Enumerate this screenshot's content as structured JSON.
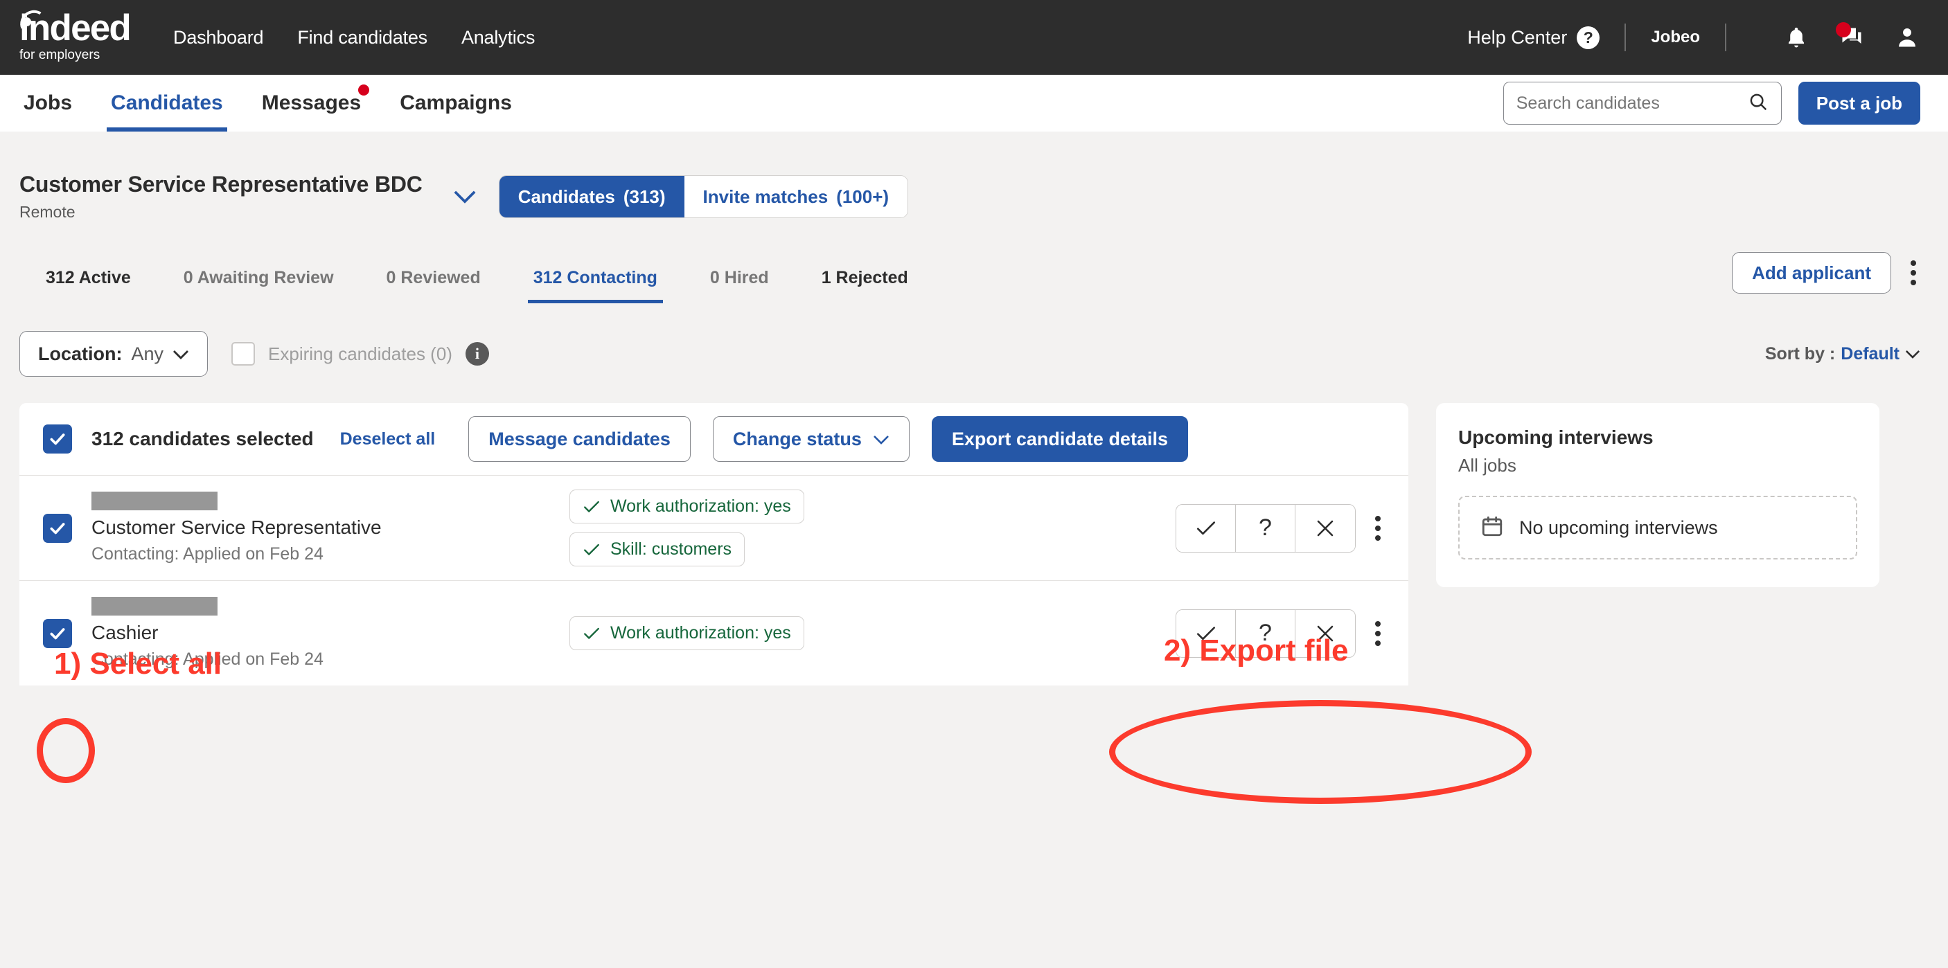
{
  "topbar": {
    "logo_word": "indeed",
    "logo_sub": "for employers",
    "nav": [
      {
        "label": "Dashboard"
      },
      {
        "label": "Find candidates"
      },
      {
        "label": "Analytics"
      }
    ],
    "help_label": "Help Center",
    "help_badge": "?",
    "account": "Jobeo",
    "icons": [
      "bell-icon",
      "messages-icon",
      "profile-icon"
    ]
  },
  "subnav": {
    "items": [
      {
        "label": "Jobs",
        "active": false,
        "dot": false
      },
      {
        "label": "Candidates",
        "active": true,
        "dot": false
      },
      {
        "label": "Messages",
        "active": false,
        "dot": true
      },
      {
        "label": "Campaigns",
        "active": false,
        "dot": false
      }
    ],
    "search_placeholder": "Search candidates",
    "search_value": "",
    "post_job_label": "Post a job"
  },
  "job": {
    "title": "Customer Service Representative BDC",
    "location": "Remote",
    "toggle": [
      {
        "label": "Candidates",
        "count": "(313)",
        "active": true
      },
      {
        "label": "Invite matches",
        "count": "(100+)",
        "active": false
      }
    ]
  },
  "tabs": [
    {
      "label": "312 Active",
      "state": "dark"
    },
    {
      "label": "0 Awaiting Review",
      "state": "muted"
    },
    {
      "label": "0 Reviewed",
      "state": "muted"
    },
    {
      "label": "312 Contacting",
      "state": "active"
    },
    {
      "label": "0 Hired",
      "state": "muted"
    },
    {
      "label": "1 Rejected",
      "state": "dark"
    }
  ],
  "tabs_right": {
    "add_applicant_label": "Add applicant",
    "kebab": "more-options-icon"
  },
  "filters": {
    "location_key": "Location:",
    "location_value": "Any",
    "expiring_label": "Expiring candidates (0)",
    "info_glyph": "i",
    "sort_key": "Sort by :",
    "sort_value": "Default"
  },
  "actionbar": {
    "selected_text": "312 candidates selected",
    "deselect_label": "Deselect all",
    "message_label": "Message candidates",
    "change_status_label": "Change status",
    "export_label": "Export candidate details"
  },
  "candidates": [
    {
      "name_redacted": true,
      "title": "Customer Service Representative",
      "meta": "Contacting: Applied on Feb 24",
      "badges": [
        "Work authorization: yes",
        "Skill: customers"
      ]
    },
    {
      "name_redacted": true,
      "title": "Cashier",
      "meta": "Contacting: Applied on Feb 24",
      "badges": [
        "Work authorization: yes"
      ]
    }
  ],
  "side_card": {
    "title": "Upcoming interviews",
    "subtitle": "All jobs",
    "empty_text": "No upcoming interviews",
    "empty_icon": "calendar-icon"
  },
  "annotations": [
    {
      "text": "1) Select all"
    },
    {
      "text": "2) Export file"
    }
  ],
  "colors": {
    "brand_blue": "#2557a7",
    "annotation_red": "#fc3b2d",
    "badge_green": "#16663b",
    "topbar_dark": "#2d2d2d"
  }
}
